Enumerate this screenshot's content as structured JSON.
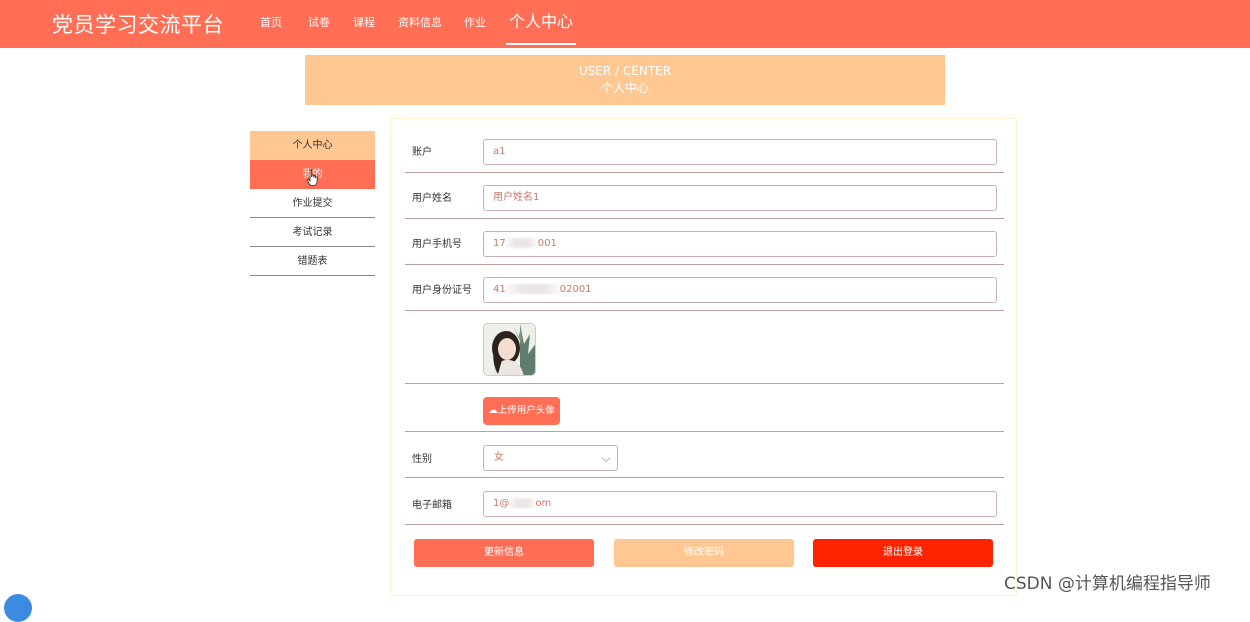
{
  "app": {
    "title": "党员学习交流平台"
  },
  "nav": {
    "items": [
      {
        "label": "首页"
      },
      {
        "label": "试卷"
      },
      {
        "label": "课程"
      },
      {
        "label": "资料信息"
      },
      {
        "label": "作业"
      },
      {
        "label": "个人中心"
      }
    ],
    "active": "个人中心"
  },
  "banner": {
    "en": "USER / CENTER",
    "cn": "个人中心"
  },
  "sidebar": {
    "items": [
      {
        "label": "个人中心"
      },
      {
        "label": "我的"
      },
      {
        "label": "作业提交"
      },
      {
        "label": "考试记录"
      },
      {
        "label": "错题表"
      }
    ]
  },
  "form": {
    "account": {
      "label": "账户",
      "value": "a1"
    },
    "name": {
      "label": "用户姓名",
      "value": "用户姓名1"
    },
    "phone": {
      "label": "用户手机号",
      "value_start": "17",
      "value_end": "001"
    },
    "idcard": {
      "label": "用户身份证号",
      "value_start": "41",
      "value_end": "02001"
    },
    "upload_label": "上传用户头像",
    "gender": {
      "label": "性别",
      "value": "女"
    },
    "email": {
      "label": "电子邮箱",
      "value_start": "1@",
      "value_end": "om"
    }
  },
  "buttons": {
    "update": "更新信息",
    "change_password": "修改密码",
    "logout": "退出登录"
  },
  "colors": {
    "primary": "#ff6e55",
    "secondary": "#ffc892",
    "danger": "#ff2400"
  },
  "watermark": "CSDN @计算机编程指导师"
}
